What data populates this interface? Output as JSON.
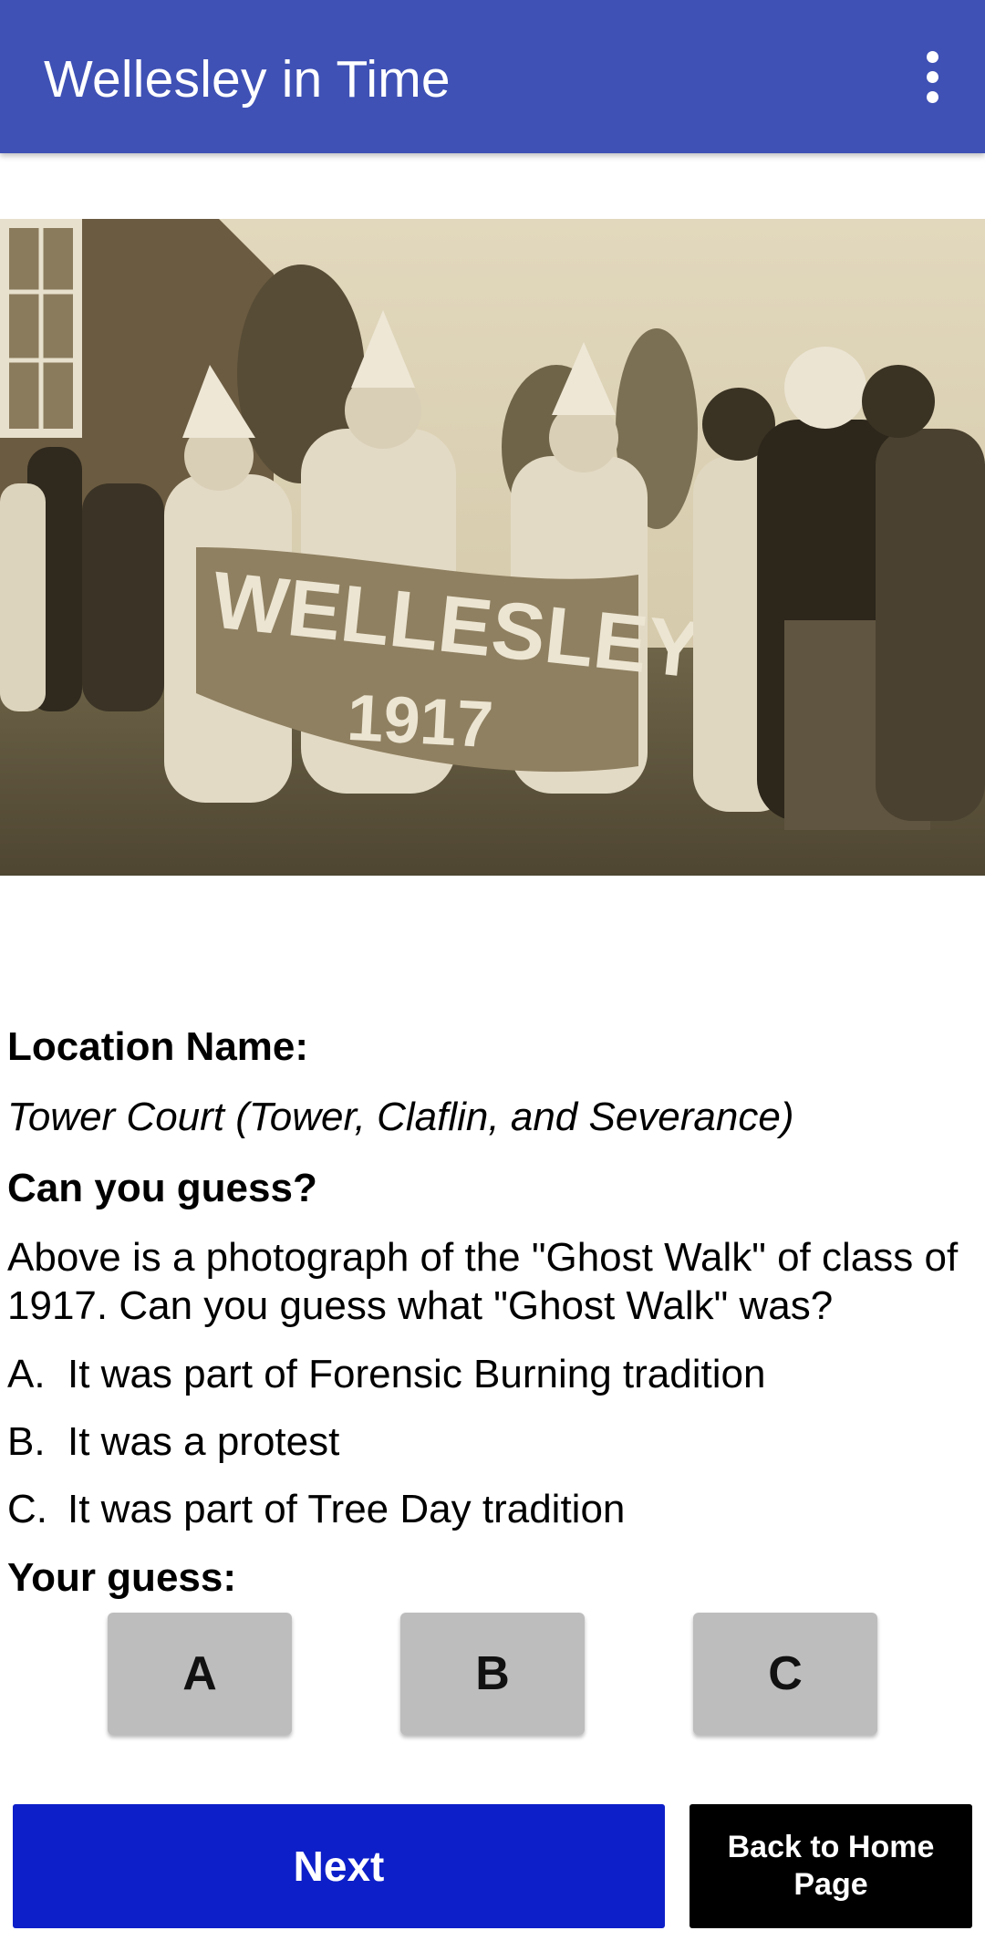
{
  "app_bar": {
    "title": "Wellesley in Time",
    "menu_icon": "more-vert-icon",
    "color": "#3f51b5"
  },
  "photo": {
    "banner_line1": "WELLESLEY",
    "banner_line2": "1917"
  },
  "location": {
    "label": "Location Name:",
    "value": "Tower Court (Tower, Claflin, and Severance)"
  },
  "question": {
    "label": "Can you guess?",
    "text": "Above is a photograph of the \"Ghost Walk\" of class of 1917. Can you guess what \"Ghost Walk\" was?",
    "options": [
      {
        "letter": "A.",
        "text": "It was part of Forensic Burning tradition"
      },
      {
        "letter": "B.",
        "text": "It was a protest"
      },
      {
        "letter": "C.",
        "text": "It was part of Tree Day tradition"
      }
    ]
  },
  "guess": {
    "label": "Your guess:",
    "buttons": [
      "A",
      "B",
      "C"
    ]
  },
  "footer": {
    "next_label": "Next",
    "home_label": "Back to Home Page",
    "next_color": "#0d1fc8",
    "home_color": "#000000"
  }
}
